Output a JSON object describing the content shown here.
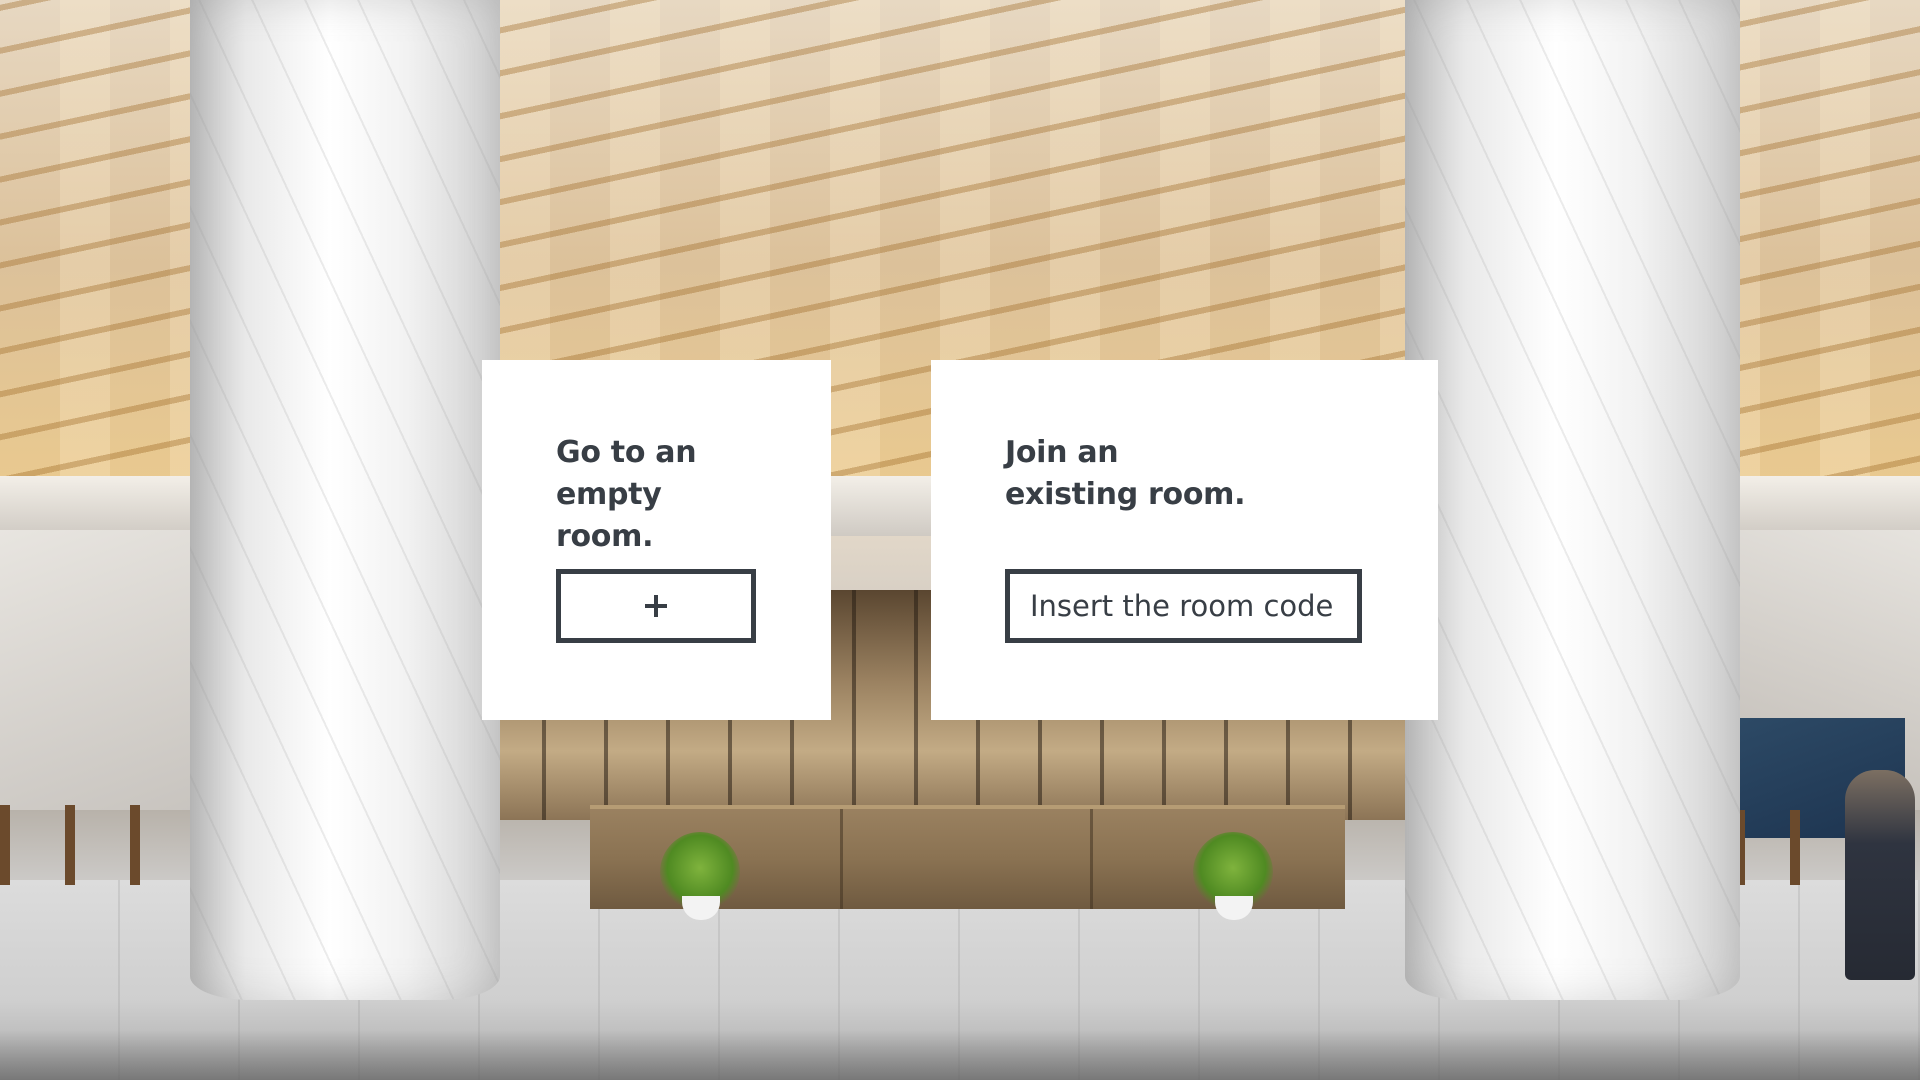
{
  "empty_room_card": {
    "title_line_1": "Go to an",
    "title_line_2": "empty room.",
    "create_button_icon": "plus-icon"
  },
  "join_room_card": {
    "title_line_1": "Join an",
    "title_line_2": "existing room.",
    "code_input": {
      "placeholder": "Insert the room code",
      "value": ""
    }
  },
  "colors": {
    "text": "#383e45",
    "card_background": "#ffffff"
  }
}
